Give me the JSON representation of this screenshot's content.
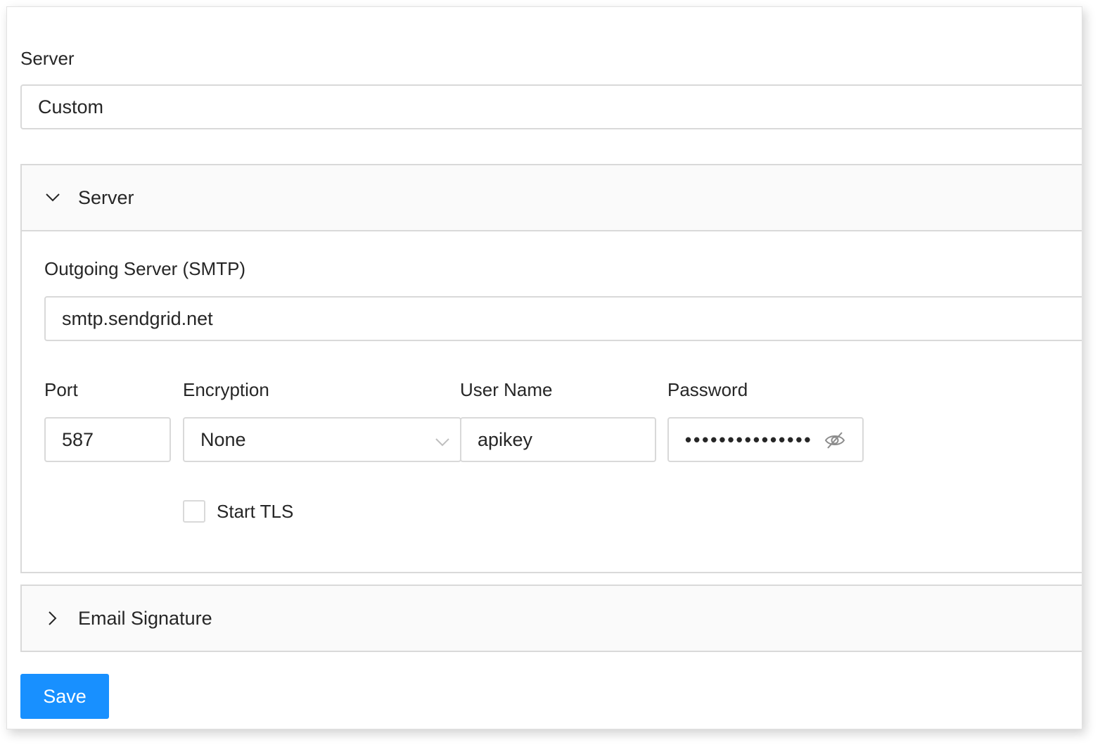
{
  "server": {
    "label": "Server",
    "value": "Custom"
  },
  "server_panel": {
    "title": "Server",
    "expanded": true,
    "outgoing": {
      "label": "Outgoing Server (SMTP)",
      "value": "smtp.sendgrid.net"
    },
    "port": {
      "label": "Port",
      "value": "587"
    },
    "encryption": {
      "label": "Encryption",
      "value": "None"
    },
    "username": {
      "label": "User Name",
      "value": "apikey"
    },
    "password": {
      "label": "Password",
      "masked": "•••••••••••••••"
    },
    "start_tls": {
      "label": "Start TLS",
      "checked": false
    }
  },
  "signature_panel": {
    "title": "Email Signature",
    "expanded": false
  },
  "save_button": {
    "label": "Save"
  },
  "colors": {
    "primary": "#1890ff",
    "border": "#d9d9d9",
    "panel_header_bg": "#fafafa"
  },
  "icons": {
    "expand": "chevron-down-icon",
    "collapse": "chevron-right-icon",
    "select": "chevron-down-icon",
    "password_toggle": "eye-slash-icon"
  }
}
